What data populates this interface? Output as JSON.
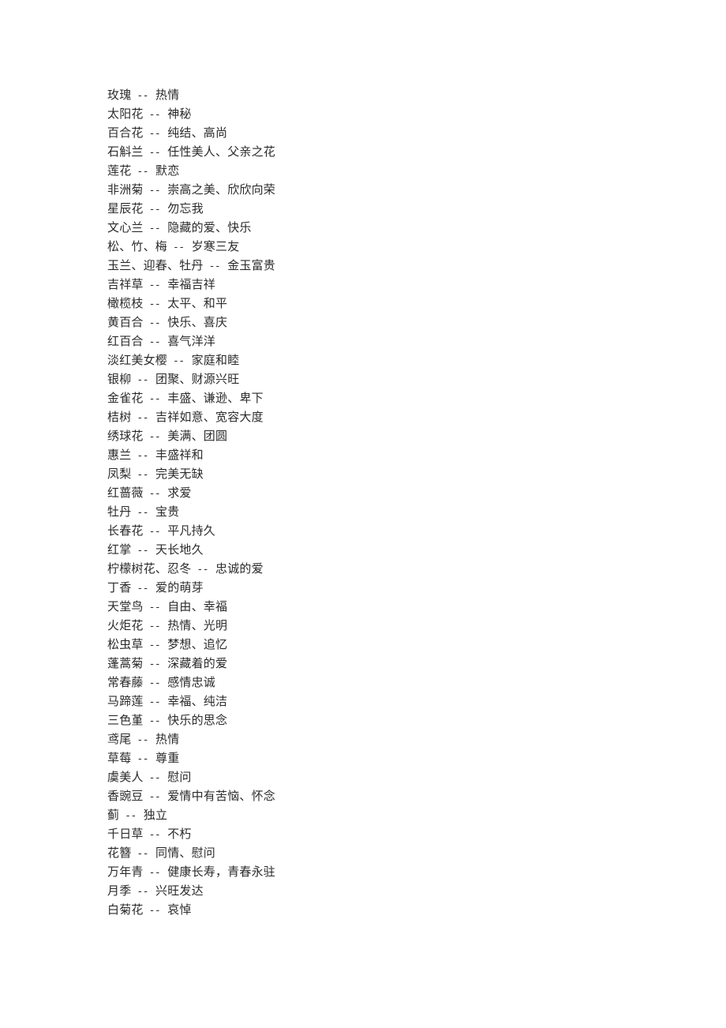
{
  "document": {
    "page_background": "#ffffff",
    "text_color": "#2b2b2b",
    "separator": "--"
  },
  "flower_meanings": [
    {
      "name": "玫瑰",
      "meaning": "热情"
    },
    {
      "name": "太阳花",
      "meaning": "神秘"
    },
    {
      "name": "百合花",
      "meaning": "纯结、高尚"
    },
    {
      "name": "石斛兰",
      "meaning": "任性美人、父亲之花"
    },
    {
      "name": "莲花",
      "meaning": "默恋"
    },
    {
      "name": "非洲菊",
      "meaning": "崇高之美、欣欣向荣"
    },
    {
      "name": "星辰花",
      "meaning": "勿忘我"
    },
    {
      "name": "文心兰",
      "meaning": "隐藏的爱、快乐"
    },
    {
      "name": "松、竹、梅",
      "meaning": "岁寒三友"
    },
    {
      "name": "玉兰、迎春、牡丹",
      "meaning": "金玉富贵"
    },
    {
      "name": "吉祥草",
      "meaning": "幸福吉祥"
    },
    {
      "name": "橄榄枝",
      "meaning": "太平、和平"
    },
    {
      "name": "黄百合",
      "meaning": "快乐、喜庆"
    },
    {
      "name": "红百合",
      "meaning": "喜气洋洋"
    },
    {
      "name": "淡红美女樱",
      "meaning": "家庭和睦"
    },
    {
      "name": "银柳",
      "meaning": "团聚、财源兴旺"
    },
    {
      "name": "金雀花",
      "meaning": "丰盛、谦逊、卑下"
    },
    {
      "name": "桔树",
      "meaning": "吉祥如意、宽容大度"
    },
    {
      "name": "绣球花",
      "meaning": "美满、团圆"
    },
    {
      "name": "惠兰",
      "meaning": "丰盛祥和"
    },
    {
      "name": "凤梨",
      "meaning": "完美无缺"
    },
    {
      "name": "红蔷薇",
      "meaning": "求爱"
    },
    {
      "name": "牡丹",
      "meaning": "宝贵"
    },
    {
      "name": "长春花",
      "meaning": "平凡持久"
    },
    {
      "name": "红掌",
      "meaning": "天长地久"
    },
    {
      "name": "柠檬树花、忍冬",
      "meaning": "忠诚的爱"
    },
    {
      "name": "丁香",
      "meaning": "爱的萌芽"
    },
    {
      "name": "天堂鸟",
      "meaning": "自由、幸福"
    },
    {
      "name": "火炬花",
      "meaning": "热情、光明"
    },
    {
      "name": "松虫草",
      "meaning": "梦想、追忆"
    },
    {
      "name": "蓬蒿菊",
      "meaning": "深藏着的爱"
    },
    {
      "name": "常春藤",
      "meaning": "感情忠诚"
    },
    {
      "name": "马蹄莲",
      "meaning": "幸福、纯洁"
    },
    {
      "name": "三色堇",
      "meaning": "快乐的思念"
    },
    {
      "name": "鸢尾",
      "meaning": "热情"
    },
    {
      "name": "草莓",
      "meaning": "尊重"
    },
    {
      "name": "虞美人",
      "meaning": "慰问"
    },
    {
      "name": "香豌豆",
      "meaning": "爱情中有苦恼、怀念"
    },
    {
      "name": "蓟",
      "meaning": "独立"
    },
    {
      "name": "千日草",
      "meaning": "不朽"
    },
    {
      "name": "花簪",
      "meaning": "同情、慰问"
    },
    {
      "name": "万年青",
      "meaning": "健康长寿，青春永驻"
    },
    {
      "name": "月季",
      "meaning": "兴旺发达"
    },
    {
      "name": "白菊花",
      "meaning": "哀悼"
    }
  ]
}
